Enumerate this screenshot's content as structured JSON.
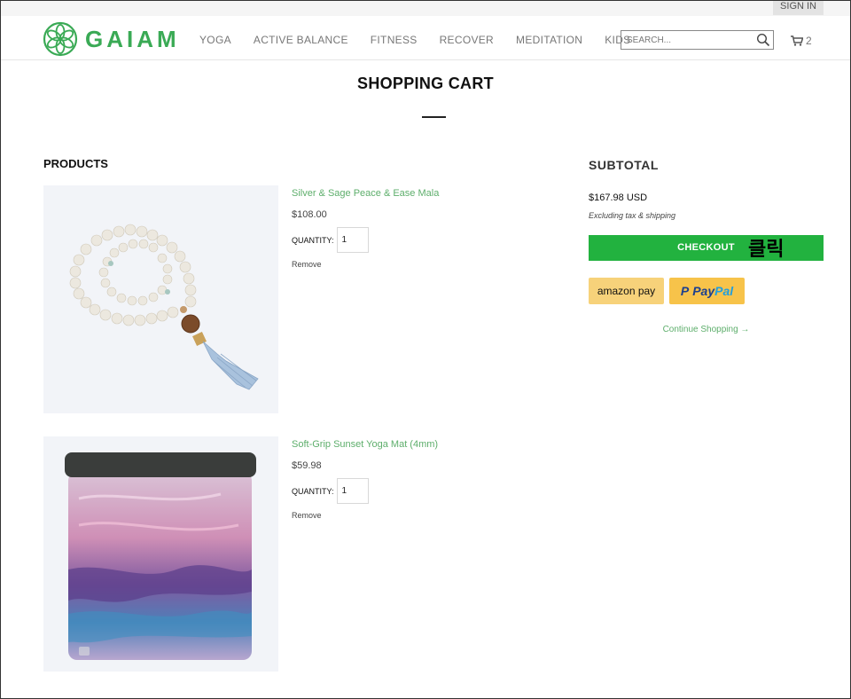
{
  "topbar": {
    "sign_in": "SIGN IN"
  },
  "brand": {
    "name": "GAIAM",
    "color": "#3aaa55"
  },
  "nav": {
    "items": [
      "YOGA",
      "ACTIVE BALANCE",
      "FITNESS",
      "RECOVER",
      "MEDITATION",
      "KIDS"
    ]
  },
  "search": {
    "placeholder": "SEARCH..."
  },
  "cart": {
    "count": "2"
  },
  "page": {
    "title": "SHOPPING CART"
  },
  "products": {
    "heading": "PRODUCTS",
    "items": [
      {
        "name": "Silver & Sage Peace & Ease Mala",
        "price": "$108.00",
        "quantity_label": "QUANTITY:",
        "quantity": "1",
        "remove_label": "Remove"
      },
      {
        "name": "Soft-Grip Sunset Yoga Mat (4mm)",
        "price": "$59.98",
        "quantity_label": "QUANTITY:",
        "quantity": "1",
        "remove_label": "Remove"
      }
    ]
  },
  "summary": {
    "heading": "SUBTOTAL",
    "amount": "$167.98 USD",
    "tax_note": "Excluding tax & shipping",
    "checkout_label": "CHECKOUT",
    "click_note": "클릭",
    "amazon_label": "amazon pay",
    "paypal_p": "P",
    "paypal_pay": "Pay",
    "paypal_pal": "Pal",
    "continue_label": "Continue Shopping →",
    "checkout_color": "#22b23f"
  }
}
